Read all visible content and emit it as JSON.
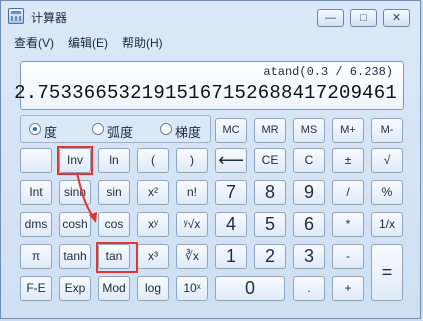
{
  "window": {
    "title": "计算器",
    "buttons": {
      "minimize": "—",
      "maximize": "□",
      "close": "✕"
    }
  },
  "menu": {
    "items": [
      "查看(V)",
      "编辑(E)",
      "帮助(H)"
    ]
  },
  "display": {
    "expression": "atand(0.3 / 6.238)",
    "result": "2.7533665321915167152688417209461"
  },
  "modes": [
    {
      "label": "度",
      "selected": true
    },
    {
      "label": "弧度",
      "selected": false
    },
    {
      "label": "梯度",
      "selected": false
    }
  ],
  "memory_row": [
    "MC",
    "MR",
    "MS",
    "M+",
    "M-"
  ],
  "keys": {
    "inv": "Inv",
    "ln": "ln",
    "lparen": "(",
    "rparen": ")",
    "backspace": "⟵",
    "ce": "CE",
    "c": "C",
    "plusminus": "±",
    "sqrt": "√",
    "int": "Int",
    "sinh": "sinh",
    "sin": "sin",
    "x2": "x²",
    "nfact": "n!",
    "seven": "7",
    "eight": "8",
    "nine": "9",
    "divide": "/",
    "percent": "%",
    "dms": "dms",
    "cosh": "cosh",
    "cos": "cos",
    "xy": "xʸ",
    "yroot": "ʸ√x",
    "four": "4",
    "five": "5",
    "six": "6",
    "multiply": "*",
    "reciprocal": "1/x",
    "pi": "π",
    "tanh": "tanh",
    "tan": "tan",
    "x3": "x³",
    "cuberoot": "∛x",
    "one": "1",
    "two": "2",
    "three": "3",
    "minus": "-",
    "equals": "=",
    "fe": "F-E",
    "exp": "Exp",
    "mod": "Mod",
    "log": "log",
    "tenx": "10ˣ",
    "zero": "0",
    "dot": ".",
    "plus": "+"
  },
  "annotation_color": "#e53434"
}
